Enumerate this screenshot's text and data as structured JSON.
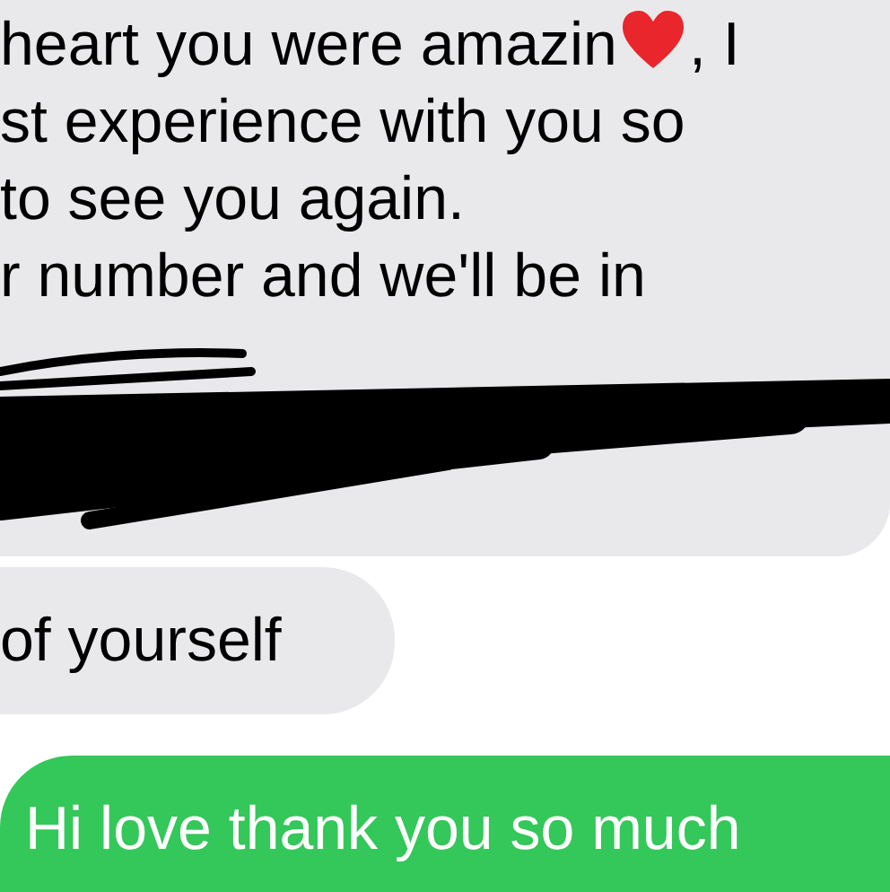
{
  "messages": [
    {
      "kind": "received",
      "lines": [
        {
          "text": "heart you were amazin",
          "after_heart": ", I",
          "heart": true
        },
        {
          "text": "st experience with you so",
          "heart": false
        },
        {
          "text": "to see you again.",
          "heart": false
        },
        {
          "text": "r number and we'll be in",
          "heart": false
        }
      ],
      "redacted": true
    },
    {
      "kind": "received",
      "lines": [
        {
          "text": "of yourself",
          "heart": false
        }
      ]
    },
    {
      "kind": "sent",
      "lines": [
        {
          "text": "Hi love thank you so much",
          "heart": false
        }
      ]
    }
  ]
}
